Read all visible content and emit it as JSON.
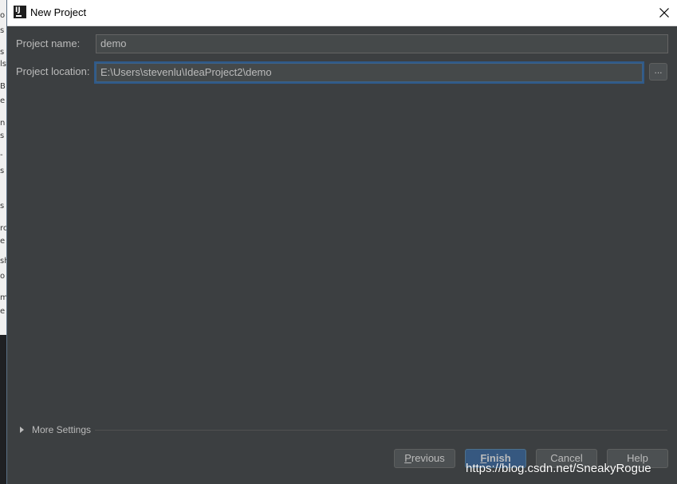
{
  "window": {
    "title": "New Project",
    "icon": "intellij-idea-icon",
    "close_icon": "close-icon"
  },
  "form": {
    "project_name": {
      "label": "Project name:",
      "value": "demo"
    },
    "project_location": {
      "label": "Project location:",
      "value": "E:\\Users\\stevenlu\\IdeaProject2\\demo"
    },
    "browse_label": "..."
  },
  "more_settings": {
    "label": "More Settings",
    "icon": "triangle-right-icon"
  },
  "buttons": {
    "previous": {
      "mnemonic": "P",
      "rest": "revious"
    },
    "finish": {
      "mnemonic": "F",
      "rest": "inish"
    },
    "cancel": "Cancel",
    "help": "Help"
  },
  "background_window_fragment": [
    "o",
    "s",
    "s",
    "ls",
    "B",
    "e",
    "n",
    "s",
    "-",
    "s",
    "s",
    "rc",
    "e",
    "sh",
    "o",
    "m",
    "e"
  ],
  "watermark": "https://blog.csdn.net/SneakyRogue",
  "colors": {
    "dialog_bg": "#3c3f41",
    "field_bg": "#45494a",
    "text": "#bbbbbb",
    "focus_ring": "#2f5a8a",
    "default_button": "#365880"
  }
}
